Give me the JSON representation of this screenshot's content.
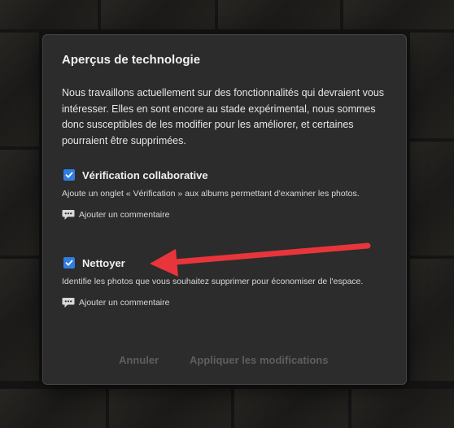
{
  "dialog": {
    "title": "Aperçus de technologie",
    "intro": "Nous travaillons actuellement sur des fonctionnalités qui devraient vous intéresser. Elles en sont encore au stade expérimental, nous sommes donc susceptibles de les modifier pour les améliorer, et certaines pourraient être supprimées.",
    "features": [
      {
        "label": "Vérification collaborative",
        "checked": true,
        "description": "Ajoute un onglet « Vérification » aux albums permettant d'examiner les photos.",
        "comment_link": "Ajouter un commentaire"
      },
      {
        "label": "Nettoyer",
        "checked": true,
        "description": "Identifie les photos que vous souhaitez supprimer pour économiser de l'espace.",
        "comment_link": "Ajouter un commentaire"
      }
    ],
    "buttons": {
      "cancel": "Annuler",
      "apply": "Appliquer les modifications"
    }
  },
  "colors": {
    "dialog_background": "#2c2c2c",
    "checkbox_accent": "#2f7de1",
    "annotation_arrow": "#e8353b",
    "disabled_button_text": "#5e5e5e"
  },
  "icons": {
    "checkbox": "checkmark-icon",
    "comment": "speech-bubble-icon",
    "annotation": "red-arrow-icon"
  }
}
